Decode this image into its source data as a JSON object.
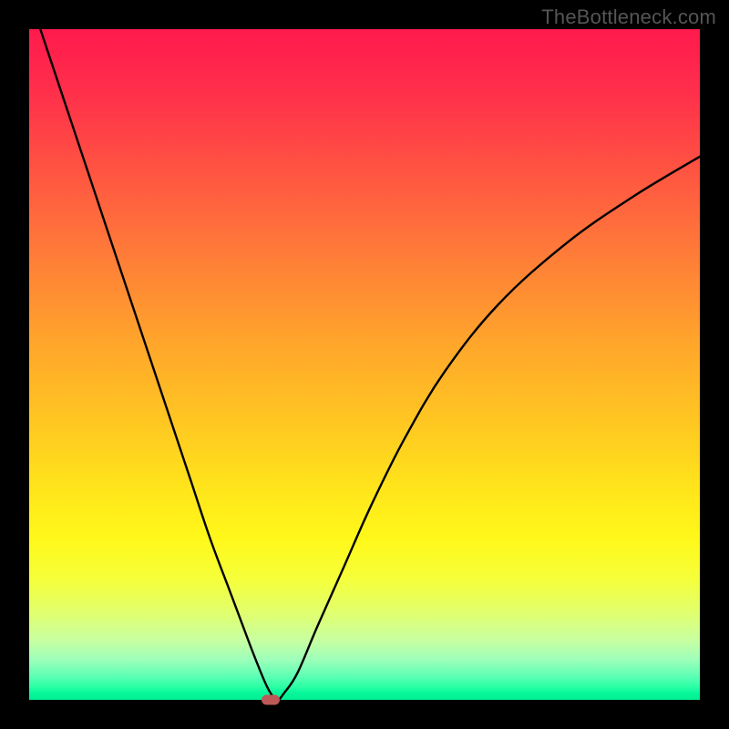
{
  "watermark": "TheBottleneck.com",
  "chart_data": {
    "type": "line",
    "title": "",
    "xlabel": "",
    "ylabel": "",
    "xlim": [
      0,
      100
    ],
    "ylim": [
      0,
      100
    ],
    "grid": false,
    "legend": false,
    "background": "rainbow-gradient (red top → green bottom)",
    "series": [
      {
        "name": "bottleneck-curve",
        "x": [
          0,
          3,
          6,
          9,
          12,
          15,
          18,
          21,
          24,
          27,
          30,
          33,
          35,
          36,
          37,
          38,
          40,
          43,
          47,
          51,
          56,
          62,
          70,
          80,
          90,
          100
        ],
        "y": [
          105,
          96,
          87,
          78,
          69,
          60,
          51,
          42,
          33,
          24,
          16,
          8,
          3,
          1,
          0,
          1,
          4,
          11,
          20,
          29,
          39,
          49,
          59,
          68,
          75,
          81
        ]
      }
    ],
    "marker": {
      "x": 36,
      "y": 0,
      "color": "#bb5a58"
    }
  },
  "colors": {
    "frame": "#000000",
    "curve": "#000000",
    "marker": "#bb5a58"
  }
}
